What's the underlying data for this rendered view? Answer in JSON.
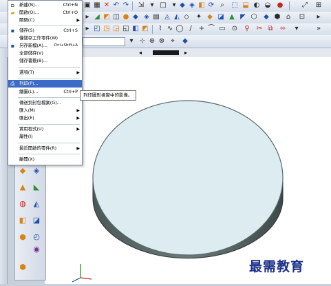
{
  "toolbar_icons": [
    "lock-icon",
    "undo-icon",
    "redo-icon",
    "select-icon",
    "cut-icon",
    "copy-icon",
    "paste-icon",
    "delete-icon",
    "save-icon",
    "print-icon",
    "snap-icon",
    "sketch-icon",
    "extrude-icon",
    "revolve-icon",
    "fit-icon",
    "zoom-icon",
    "rotate-icon",
    "pan-icon",
    "shade-icon",
    "help-icon"
  ],
  "file_menu": {
    "items": [
      {
        "icon": "new-file-icon",
        "label": "新建(N)...",
        "shortcut": "Ctrl+N"
      },
      {
        "icon": "open-folder-icon",
        "label": "開啟(O)...",
        "shortcut": "Ctrl+O"
      },
      {
        "icon": "",
        "label": "關閉(C)",
        "shortcut": "",
        "submenu": true
      },
      {
        "icon": "save-icon",
        "label": "儲存(S)",
        "shortcut": "Ctrl+S"
      },
      {
        "icon": "",
        "label": "僅儲存工作零件(W)",
        "shortcut": ""
      },
      {
        "icon": "save-as-icon",
        "label": "另存新檔(A)...",
        "shortcut": "Ctrl+Shift+A"
      },
      {
        "icon": "",
        "label": "全部儲存(V)",
        "shortcut": ""
      },
      {
        "icon": "",
        "label": "儲存書籤(B)...",
        "shortcut": ""
      },
      {
        "icon": "",
        "label": "選項(T)",
        "shortcut": "",
        "submenu": true
      },
      {
        "icon": "print-icon",
        "label": "列印(P)...",
        "shortcut": "",
        "highlighted": true
      },
      {
        "icon": "",
        "label": "繪圖(L)...",
        "shortcut": "Ctrl+P"
      },
      {
        "icon": "",
        "label": "傳送到封包檔案(G)...",
        "shortcut": ""
      },
      {
        "icon": "",
        "label": "匯入(M)",
        "shortcut": "",
        "submenu": true
      },
      {
        "icon": "",
        "label": "匯出(E)",
        "shortcut": "",
        "submenu": true
      },
      {
        "icon": "",
        "label": "實用程式(U)",
        "shortcut": "",
        "submenu": true
      },
      {
        "icon": "",
        "label": "屬性(I)",
        "shortcut": ""
      },
      {
        "icon": "",
        "label": "最近開啟的零件(R)",
        "shortcut": "",
        "submenu": true
      },
      {
        "icon": "",
        "label": "離開(X)",
        "shortcut": ""
      }
    ]
  },
  "tooltip": "列印圖形視窗中的影像。",
  "watermark": "最需教育",
  "colors": {
    "menu_highlight": "#3b6bc6",
    "cylinder_top": "#dfeef1",
    "cylinder_side": "#5e6e6d"
  }
}
